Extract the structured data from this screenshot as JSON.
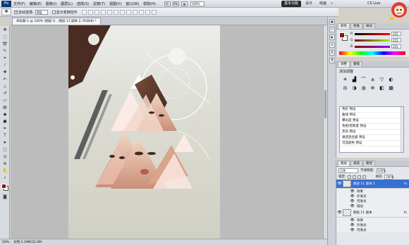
{
  "menubar": {
    "logo": "Ps",
    "items": [
      "文件(F)",
      "编辑(E)",
      "图像(I)",
      "图层(L)",
      "选择(S)",
      "滤镜(T)",
      "视图(V)",
      "窗口(W)",
      "帮助(H)"
    ],
    "zoom": "100%",
    "workspaces": [
      "基本功能",
      "设计",
      "绘画"
    ],
    "more": "»",
    "cslive": "CS Live"
  },
  "options": {
    "auto_select_label": "自动选择:",
    "auto_select_value": "图层",
    "show_transform_label": "显示变换控件"
  },
  "document": {
    "tabs": [
      "未标题-1 @ 100% (图层 0...",
      "图层 11 副本 2, RGB/8) *"
    ]
  },
  "status": {
    "zoom": "50%",
    "doc_size": "文档:3.39M/52.0M"
  },
  "color_panel": {
    "tabs": [
      "颜色",
      "色板",
      "样式"
    ],
    "r_label": "R",
    "r_value": "255",
    "g_label": "G",
    "g_value": "255",
    "b_label": "B",
    "b_value": "255",
    "fg_color": "#8b1515",
    "bg_color": "#ffffff"
  },
  "adjustments_panel": {
    "tabs": [
      "调整",
      "蒙版"
    ],
    "title": "添加调整",
    "presets": [
      "色阶 预设",
      "曲线 预设",
      "曝光度 预设",
      "色相/饱和度 预设",
      "黑白 预设",
      "通道混合器 预设",
      "可选颜色 预设"
    ]
  },
  "layers_panel": {
    "tabs": [
      "图层",
      "通道",
      "路径"
    ],
    "blend_mode": "正常",
    "opacity_label": "不透明度:",
    "opacity_value": "100%",
    "lock_label": "锁定:",
    "fill_label": "填充:",
    "fill_value": "100%",
    "layers": [
      {
        "name": "图层 11 副本 2",
        "fx": "fx",
        "selected": true
      },
      {
        "name": "图层 11 副本",
        "fx": "fx",
        "selected": false
      }
    ],
    "effects_a": [
      "效果",
      "外发光",
      "内发光",
      "描边"
    ],
    "effects_b": [
      "效果",
      "外发光",
      "内发光"
    ]
  }
}
